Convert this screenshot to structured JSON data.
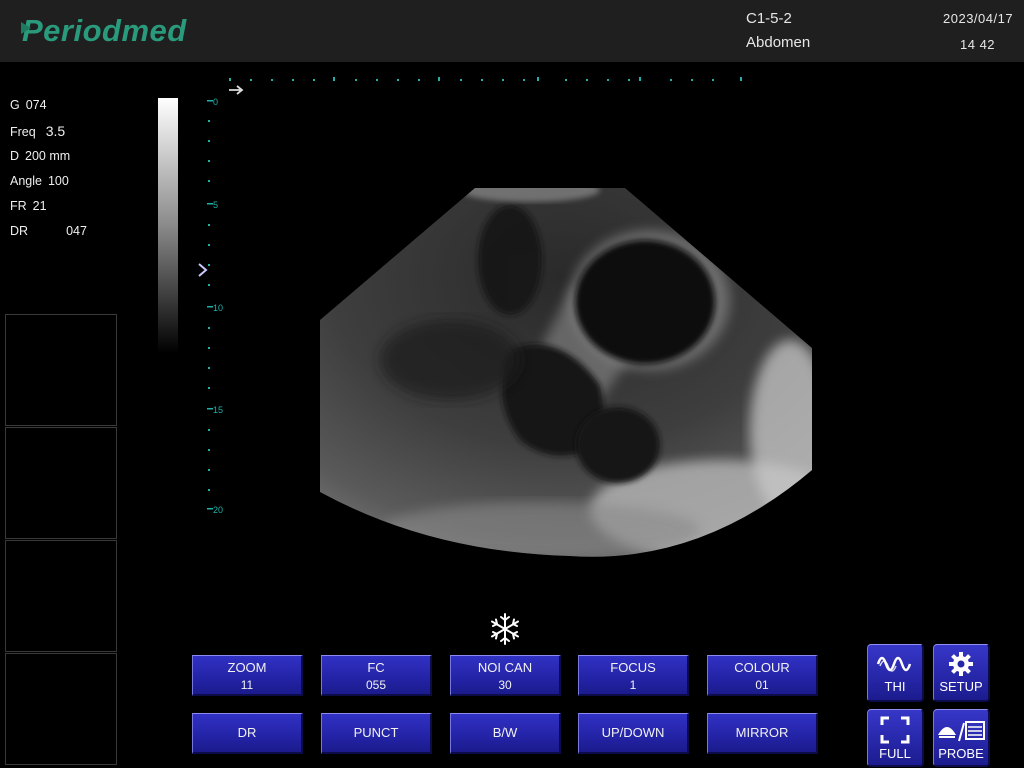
{
  "header": {
    "logo": "Periodmed",
    "probe_code": "C1-5-2",
    "exam": "Abdomen",
    "date": "2023/04/17",
    "time": "14 42"
  },
  "params": [
    {
      "label": "G",
      "value": "074"
    },
    {
      "label": "Freq",
      "value": "3.5"
    },
    {
      "label": "D",
      "value": "200 mm"
    },
    {
      "label": "Angle",
      "value": "100"
    },
    {
      "label": "FR",
      "value": "21"
    },
    {
      "label": "DR",
      "value": "047"
    }
  ],
  "depth_scale": {
    "labels": [
      "0",
      "5",
      "10",
      "15",
      "20"
    ],
    "color": "#1fb0a8"
  },
  "buttons_row1": [
    {
      "label": "ZOOM",
      "value": "11"
    },
    {
      "label": "FC",
      "value": "055"
    },
    {
      "label": "NOI CAN",
      "value": "30"
    },
    {
      "label": "FOCUS",
      "value": "1"
    },
    {
      "label": "COLOUR",
      "value": "01"
    }
  ],
  "buttons_row2": [
    "DR",
    "PUNCT",
    "B/W",
    "UP/DOWN",
    "MIRROR"
  ],
  "icon_buttons": {
    "thi": "THI",
    "setup": "SETUP",
    "full": "FULL",
    "probe": "PROBE"
  },
  "icons": {
    "freeze": "snowflake-icon",
    "thi": "waveform-icon",
    "setup": "gear-icon",
    "full": "fullscreen-icon",
    "probe": "probe-icon"
  },
  "colors": {
    "button_blue": "#2626a8",
    "logo_green": "#2a9a7c",
    "scale_cyan": "#1fb0a8"
  }
}
